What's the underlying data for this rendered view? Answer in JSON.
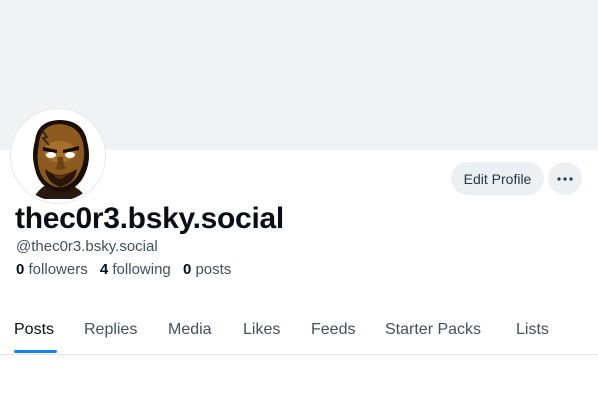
{
  "profile": {
    "display_name": "thec0r3.bsky.social",
    "handle": "@thec0r3.bsky.social",
    "avatar_icon": "avatar-cartoon-face"
  },
  "actions": {
    "edit_profile_label": "Edit Profile",
    "more_icon": "more-horizontal-icon"
  },
  "stats": {
    "followers_count": "0",
    "followers_label": "followers",
    "following_count": "4",
    "following_label": "following",
    "posts_count": "0",
    "posts_label": "posts"
  },
  "tabs": [
    {
      "label": "Posts",
      "active": true
    },
    {
      "label": "Replies",
      "active": false
    },
    {
      "label": "Media",
      "active": false
    },
    {
      "label": "Likes",
      "active": false
    },
    {
      "label": "Feeds",
      "active": false
    },
    {
      "label": "Starter Packs",
      "active": false
    },
    {
      "label": "Lists",
      "active": false
    }
  ],
  "colors": {
    "accent": "#1083fe",
    "banner": "#f1f2f4",
    "button_bg": "#edf0f3",
    "muted_text": "#45505c"
  }
}
